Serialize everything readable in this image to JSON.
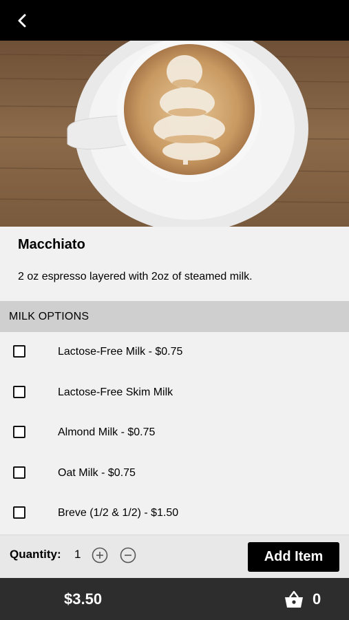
{
  "header": {
    "back_icon": "chevron-left-icon"
  },
  "product": {
    "image_description_icon": "coffee-photo",
    "name": "Macchiato",
    "description": "2 oz espresso layered with 2oz of steamed milk."
  },
  "milk_options": {
    "title": "MILK OPTIONS",
    "items": [
      {
        "label": "Lactose-Free Milk - $0.75",
        "checked": false
      },
      {
        "label": "Lactose-Free Skim Milk",
        "checked": false
      },
      {
        "label": "Almond Milk - $0.75",
        "checked": false
      },
      {
        "label": "Oat Milk - $0.75",
        "checked": false
      },
      {
        "label": "Breve (1/2 & 1/2) - $1.50",
        "checked": false
      }
    ]
  },
  "quantity": {
    "label": "Quantity:",
    "value": "1",
    "increment_icon": "plus-circle-icon",
    "decrement_icon": "minus-circle-icon"
  },
  "actions": {
    "add_label": "Add Item"
  },
  "footer": {
    "total": "$3.50",
    "basket_icon": "basket-icon",
    "basket_count": "0"
  },
  "colors": {
    "topbar": "#000000",
    "section": "#cfcfcf",
    "footer": "#2d2d2d",
    "button": "#000000"
  }
}
